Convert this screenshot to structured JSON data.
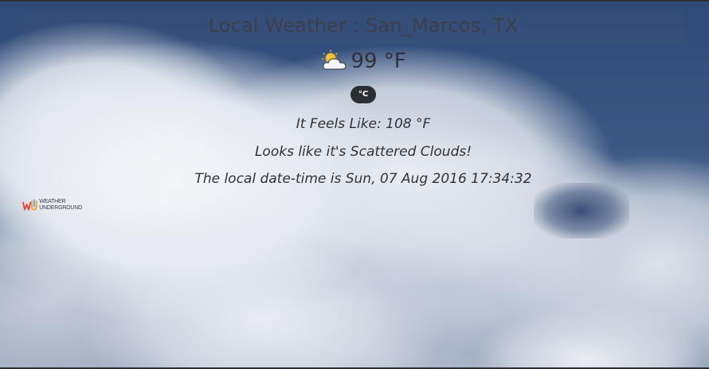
{
  "location": {
    "title": "Local Weather : San_Marcos, TX"
  },
  "current": {
    "temperature": "99 °F",
    "unit_toggle": "°C",
    "feels_like": "It Feels Like: 108 °F",
    "condition": "Looks like it's Scattered Clouds!",
    "local_datetime": "The local date-time is Sun, 07 Aug 2016 17:34:32",
    "icon": "partly-cloudy-icon"
  },
  "branding": {
    "logo_text_line1": "WEATHER",
    "logo_text_line2": "UNDERGROUND",
    "icon": "weather-underground-logo"
  },
  "colors": {
    "toggle_bg": "#2b2e33",
    "text": "#2f3339"
  }
}
